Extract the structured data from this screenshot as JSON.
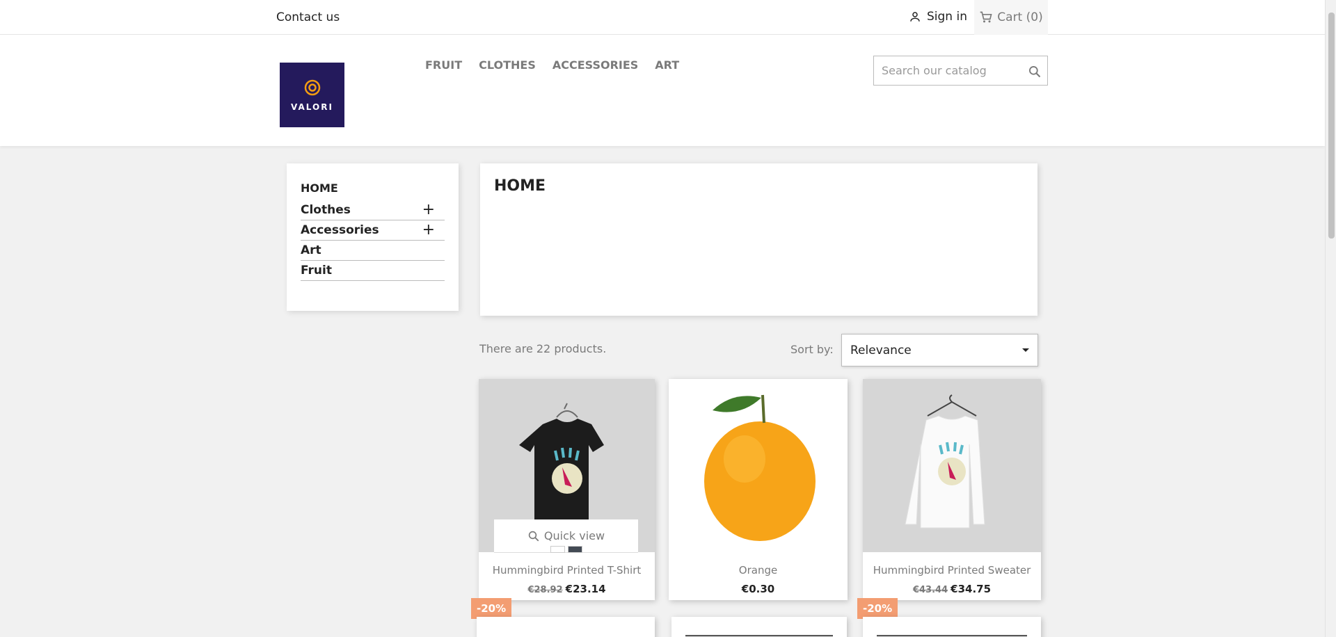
{
  "topbar": {
    "contact": "Contact us",
    "signin": "Sign in",
    "cart": "Cart (0)"
  },
  "header": {
    "logo_text": "VALORI",
    "menu": [
      "FRUIT",
      "CLOTHES",
      "ACCESSORIES",
      "ART"
    ],
    "search_placeholder": "Search our catalog"
  },
  "sidebar": {
    "title": "HOME",
    "items": [
      {
        "label": "Clothes",
        "expand": "+"
      },
      {
        "label": "Accessories",
        "expand": "+"
      },
      {
        "label": "Art"
      },
      {
        "label": "Fruit"
      }
    ]
  },
  "main": {
    "title": "HOME",
    "count": "There are 22 products.",
    "sort_label": "Sort by:",
    "sort_value": "Relevance"
  },
  "products": [
    {
      "name": "Hummingbird Printed T-Shirt",
      "old_price": "€28.92",
      "price": "€23.14",
      "badge": "-20%",
      "quick_view": "Quick view"
    },
    {
      "name": "Orange",
      "price": "€0.30"
    },
    {
      "name": "Hummingbird Printed Sweater",
      "old_price": "€43.44",
      "price": "€34.75",
      "badge": "-20%"
    }
  ],
  "colors": {
    "logo_bg": "#241a5c",
    "logo_accent": "#f39c12",
    "badge": "#f39d72"
  }
}
